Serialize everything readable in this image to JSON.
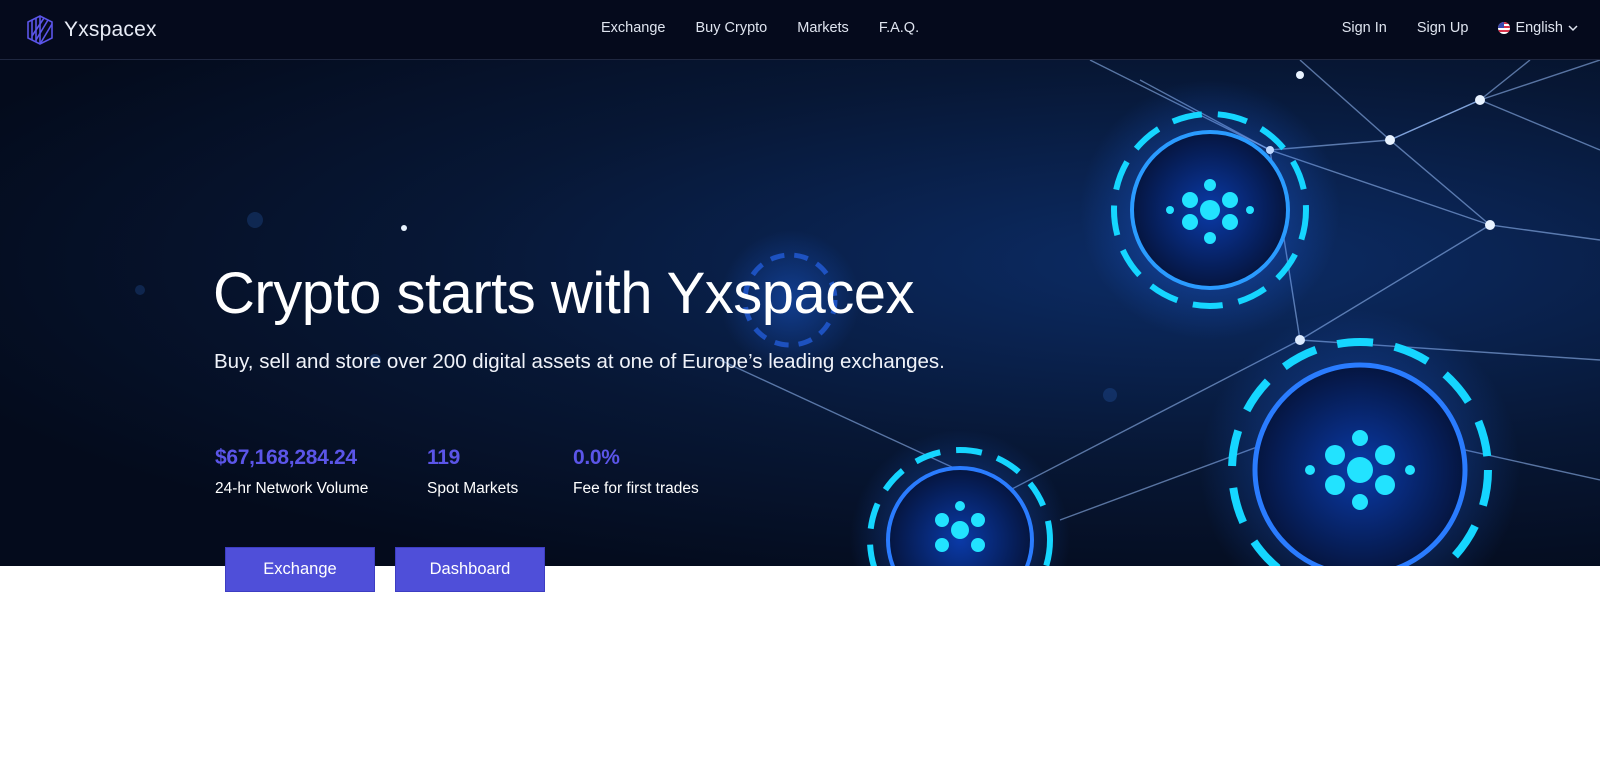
{
  "brand": {
    "name": "Yxspacex",
    "logo_icon": "striped-cube-logo-icon",
    "accent": "#4f4fd9"
  },
  "nav": {
    "items": [
      {
        "label": "Exchange"
      },
      {
        "label": "Buy Crypto"
      },
      {
        "label": "Markets"
      },
      {
        "label": "F.A.Q."
      }
    ],
    "sign_in": "Sign In",
    "sign_up": "Sign Up",
    "language": {
      "label": "English",
      "icon": "us-flag-icon"
    }
  },
  "hero": {
    "title": "Crypto starts with Yxspacex",
    "subtitle": "Buy, sell and store over 200 digital assets at one of Europe’s leading exchanges.",
    "stats": [
      {
        "value": "$67,168,284.24",
        "label": "24-hr Network Volume"
      },
      {
        "value": "119",
        "label": "Spot Markets"
      },
      {
        "value": "0.0%",
        "label": "Fee for first trades"
      }
    ],
    "stat_color": "#5b55e8"
  },
  "actions": {
    "exchange": "Exchange",
    "dashboard": "Dashboard"
  }
}
